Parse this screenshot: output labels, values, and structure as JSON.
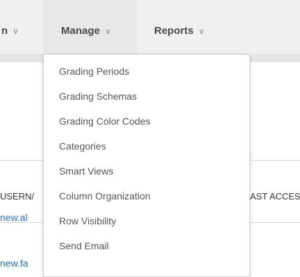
{
  "nav": {
    "left_partial": "n",
    "manage": "Manage",
    "reports": "Reports",
    "chevron": "∨"
  },
  "dropdown_items": [
    "Grading Periods",
    "Grading Schemas",
    "Grading Color Codes",
    "Categories",
    "Smart Views",
    "Column Organization",
    "Row Visibility",
    "Send Email"
  ],
  "grid": {
    "col_username": "USERN/",
    "col_last_access": "AST ACCES",
    "rows": [
      "new.al",
      "new.fa"
    ]
  }
}
